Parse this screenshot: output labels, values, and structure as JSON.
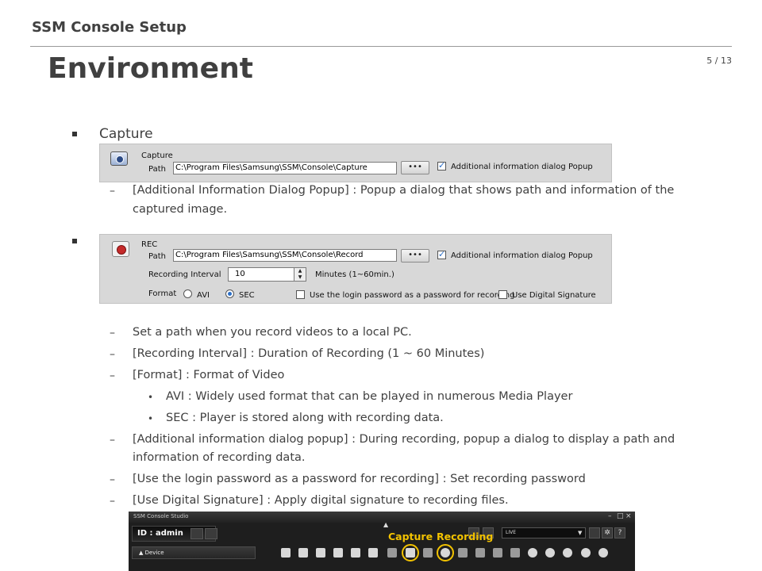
{
  "header": {
    "section_title": "SSM Console Setup",
    "page_number": "5 / 13"
  },
  "page_title": "Environment",
  "capture": {
    "bullet_label": "Capture",
    "panel": {
      "heading": "Capture",
      "path_label": "Path",
      "path_value": "C:\\Program Files\\Samsung\\SSM\\Console\\Capture",
      "browse_label": "•••",
      "popup_checkbox_label": "Additional information dialog Popup",
      "popup_checked": true
    },
    "notes": [
      {
        "line1": "[Additional Information Dialog Popup] : Popup a dialog that shows path and information of the",
        "line2": "captured image."
      }
    ]
  },
  "rec": {
    "panel": {
      "heading": "REC",
      "path_label": "Path",
      "path_value": "C:\\Program Files\\Samsung\\SSM\\Console\\Record",
      "browse_label": "•••",
      "popup_checkbox_label": "Additional information dialog Popup",
      "popup_checked": true,
      "interval_label": "Recording Interval",
      "interval_value": "10",
      "interval_unit": "Minutes (1~60min.)",
      "format_label": "Format",
      "format_options": [
        "AVI",
        "SEC"
      ],
      "format_selected": "SEC",
      "login_password_label": "Use the login password as a password for recording",
      "digital_signature_label": "Use Digital Signature"
    },
    "notes": [
      "Set a path when you record videos to a local PC.",
      "[Recording Interval] : Duration of Recording (1 ~ 60 Minutes)",
      "[Format] : Format of Video"
    ],
    "format_items": [
      "AVI : Widely used format that can be played in numerous Media Player",
      "SEC  : Player is stored along with recording data."
    ],
    "more_notes": {
      "popup_line1": "[Additional information dialog popup] : During recording, popup a dialog to display a path and",
      "popup_line2": "information of recording data.",
      "password": "[Use the login password as a password for recording] : Set recording password",
      "signature": "[Use Digital Signature] : Apply digital signature to recording files."
    }
  },
  "studio": {
    "title": "SSM Console Studio",
    "id_text": "ID : admin",
    "live_value": "LIVE",
    "device_label": "▲ Device",
    "capture_label": "Capture",
    "recording_label": "Recording",
    "highlight_color": "#f2c200",
    "help_label": "?"
  }
}
